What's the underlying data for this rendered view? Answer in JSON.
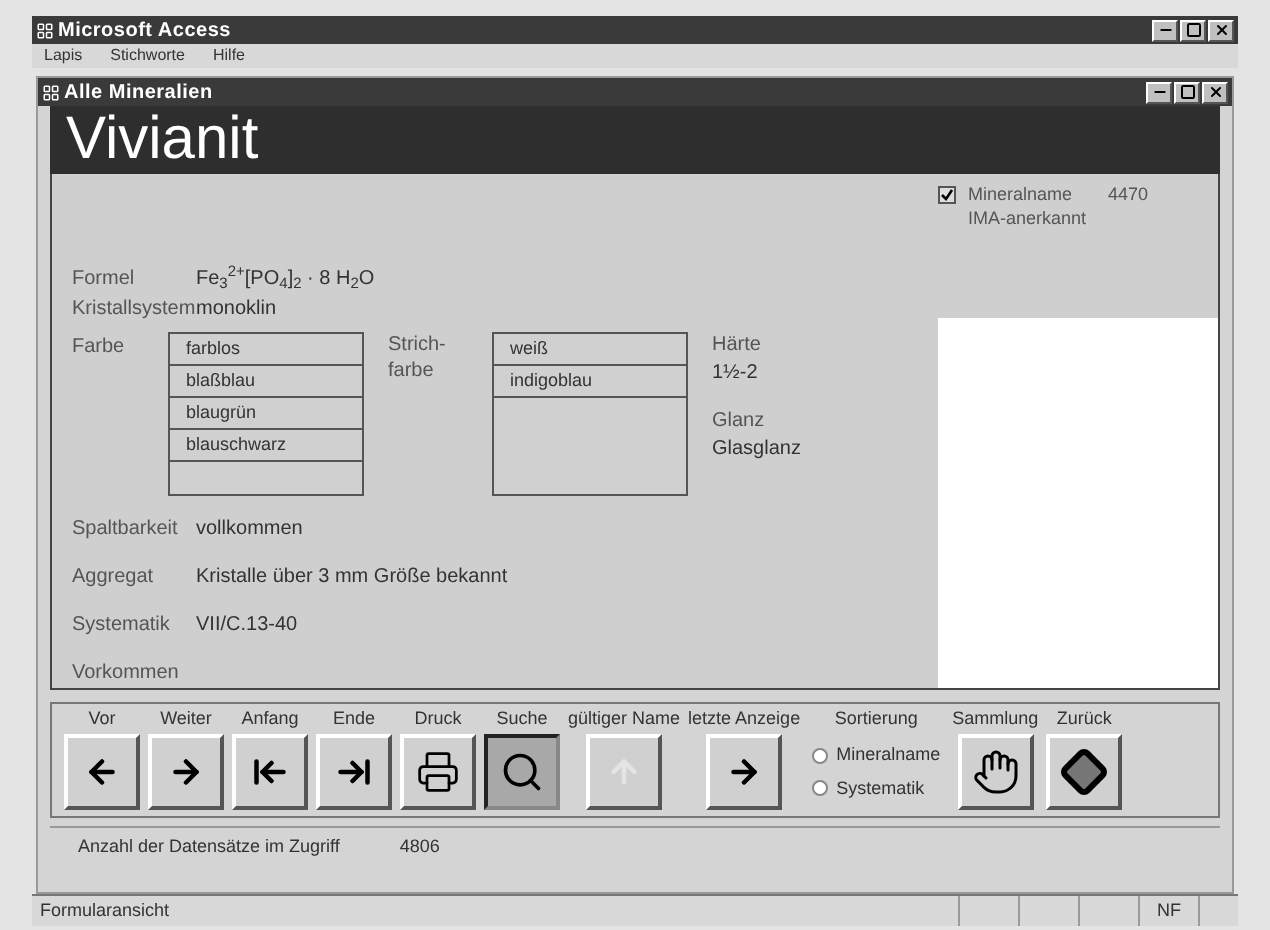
{
  "app_window": {
    "title": "Microsoft Access"
  },
  "menu": [
    "Lapis",
    "Stichworte",
    "Hilfe"
  ],
  "form_window": {
    "title": "Alle Mineralien"
  },
  "mineral_name": "Vivianit",
  "ima_checkbox": {
    "label": "Mineralname IMA-anerkannt",
    "checked": true
  },
  "record_id": "4470",
  "fields": [
    {
      "label": "Formel",
      "value": "Fe$_{3}$$^{2+}$[PO$_{4}$]$_{2}$ · 8 H$_{2}$O"
    },
    {
      "label": "Kristallsystem",
      "value": "monoklin"
    }
  ],
  "farbe": {
    "label": "Farbe",
    "items": [
      "farblos",
      "blaßblau",
      "blaugrün",
      "blauschwarz"
    ]
  },
  "strichfarbe": {
    "label": "Strich-\nfarbe",
    "items": [
      "weiß",
      "indigoblau"
    ]
  },
  "haerte": {
    "label": "Härte",
    "value": "1½-2"
  },
  "glanz": {
    "label": "Glanz",
    "value": "Glasglanz"
  },
  "fields2": [
    {
      "label": "Spaltbarkeit",
      "value": "vollkommen"
    },
    {
      "label": "Aggregat",
      "value": "Kristalle über 3 mm Größe bekannt"
    },
    {
      "label": "Systematik",
      "value": "VII/C.13-40"
    },
    {
      "label": "Vorkommen"
    }
  ],
  "toolbar": [
    {
      "label": "Vor",
      "kind": "prev",
      "disabled": false,
      "pressed": false
    },
    {
      "label": "Weiter",
      "kind": "next",
      "disabled": false,
      "pressed": false
    },
    {
      "label": "Anfang",
      "kind": "first",
      "disabled": false,
      "pressed": false
    },
    {
      "label": "Ende",
      "kind": "last",
      "disabled": false,
      "pressed": false
    },
    {
      "label": "Druck",
      "kind": "print",
      "disabled": false,
      "pressed": false
    },
    {
      "label": "Suche",
      "kind": "search",
      "disabled": false,
      "pressed": true
    },
    {
      "label": "gültiger Name",
      "kind": "up",
      "disabled": true,
      "pressed": false
    },
    {
      "label": "letzte Anzeige",
      "kind": "next",
      "disabled": false,
      "pressed": false
    }
  ],
  "sorting": {
    "label": "Sortierung",
    "options": [
      {
        "label": "Mineralname",
        "selected": false
      },
      {
        "label": "Systematik",
        "selected": false
      }
    ]
  },
  "toolbar2": [
    {
      "label": "Sammlung",
      "kind": "hand",
      "disabled": false,
      "pressed": false
    },
    {
      "label": "Zurück",
      "kind": "diamond",
      "disabled": false,
      "pressed": false
    }
  ],
  "record_count": {
    "label": "Anzahl der Datensätze im Zugriff",
    "value": "4806"
  },
  "status_bar": {
    "text": "Formularansicht",
    "indicator": "NF"
  }
}
